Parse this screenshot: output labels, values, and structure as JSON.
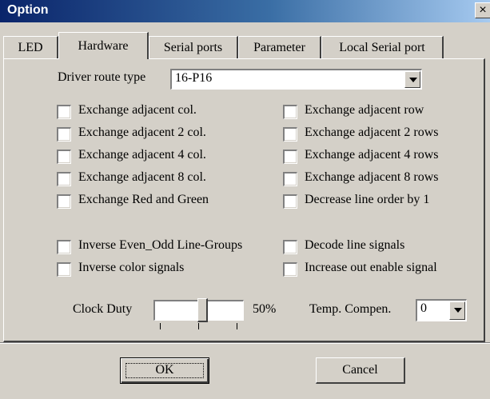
{
  "window": {
    "title": "Option",
    "close_symbol": "×"
  },
  "tabs": [
    {
      "label": "LED",
      "active": false
    },
    {
      "label": "Hardware",
      "active": true
    },
    {
      "label": "Serial ports",
      "active": false
    },
    {
      "label": "Parameter",
      "active": false
    },
    {
      "label": "Local Serial port",
      "active": false
    }
  ],
  "hardware": {
    "driver_route_label": "Driver route type",
    "driver_route_value": "16-P16",
    "checkboxes_left": [
      {
        "label": "Exchange adjacent col.",
        "checked": false
      },
      {
        "label": "Exchange adjacent 2 col.",
        "checked": false
      },
      {
        "label": "Exchange adjacent 4 col.",
        "checked": false
      },
      {
        "label": "Exchange adjacent 8 col.",
        "checked": false
      },
      {
        "label": "Exchange Red and Green",
        "checked": false
      },
      {
        "label": "Inverse Even_Odd Line-Groups",
        "checked": false
      },
      {
        "label": "Inverse color signals",
        "checked": false
      }
    ],
    "checkboxes_right": [
      {
        "label": "Exchange adjacent row",
        "checked": false
      },
      {
        "label": "Exchange adjacent 2 rows",
        "checked": false
      },
      {
        "label": "Exchange adjacent 4 rows",
        "checked": false
      },
      {
        "label": "Exchange adjacent 8 rows",
        "checked": false
      },
      {
        "label": "Decrease line order by 1",
        "checked": false
      },
      {
        "label": "Decode line signals",
        "checked": false
      },
      {
        "label": "Increase out enable signal",
        "checked": false
      }
    ],
    "clock_duty_label": "Clock Duty",
    "clock_duty_value": "50%",
    "clock_duty_fraction": 0.5,
    "temp_comp_label": "Temp. Compen.",
    "temp_comp_value": "0"
  },
  "buttons": {
    "ok": "OK",
    "cancel": "Cancel"
  },
  "colors": {
    "titlebar_start": "#0a246a",
    "titlebar_end": "#a6caf0",
    "face": "#d4d0c8"
  }
}
